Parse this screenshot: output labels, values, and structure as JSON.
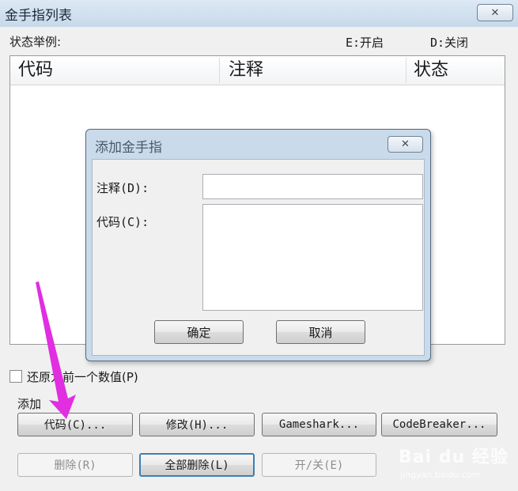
{
  "window": {
    "title": "金手指列表",
    "close_glyph": "✕",
    "status_example_label": "状态举例:",
    "status_e": "E:开启",
    "status_d": "D:关闭",
    "columns": [
      "代码",
      "注释",
      "状态"
    ],
    "restore_checkbox_label": "还原为前一个数值(P)",
    "restore_checked": false,
    "add_group_label": "添加",
    "buttons": {
      "code": "代码(C)...",
      "modify": "修改(H)...",
      "gameshark": "Gameshark...",
      "codebreaker": "CodeBreaker...",
      "delete": "删除(R)",
      "delete_all": "全部删除(L)",
      "toggle": "开/关(E)"
    }
  },
  "dialog": {
    "title": "添加金手指",
    "close_glyph": "✕",
    "note_label": "注释(D):",
    "note_value": "",
    "code_label": "代码(C):",
    "code_value": "",
    "ok_label": "确定",
    "cancel_label": "取消"
  },
  "annotation": {
    "color": "#e02ee0"
  },
  "watermark": {
    "brand": "Bai du 经验",
    "url": "jingyan.baidu.com"
  }
}
